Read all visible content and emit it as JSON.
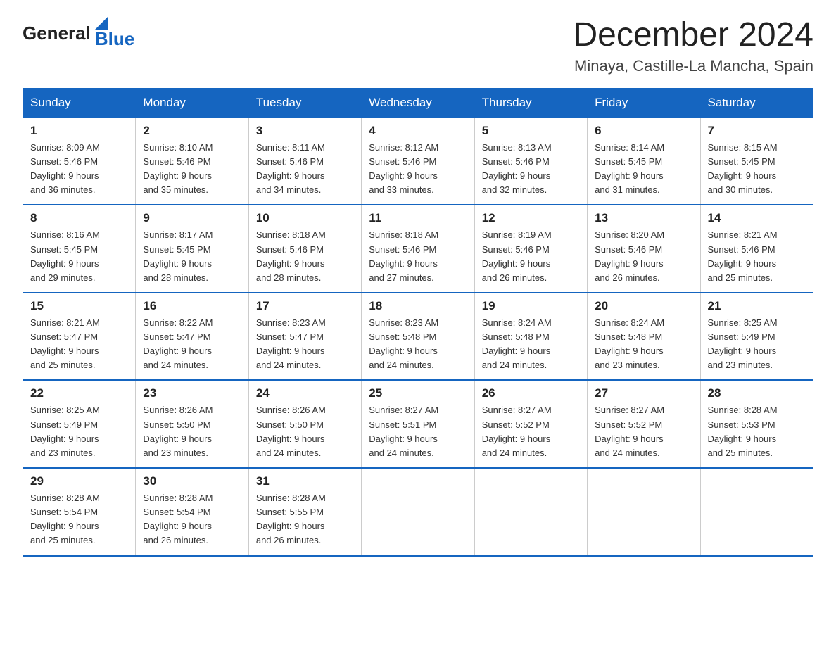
{
  "logo": {
    "general": "General",
    "blue": "Blue"
  },
  "title": "December 2024",
  "subtitle": "Minaya, Castille-La Mancha, Spain",
  "days_of_week": [
    "Sunday",
    "Monday",
    "Tuesday",
    "Wednesday",
    "Thursday",
    "Friday",
    "Saturday"
  ],
  "weeks": [
    [
      {
        "num": "1",
        "sunrise": "8:09 AM",
        "sunset": "5:46 PM",
        "daylight": "9 hours and 36 minutes."
      },
      {
        "num": "2",
        "sunrise": "8:10 AM",
        "sunset": "5:46 PM",
        "daylight": "9 hours and 35 minutes."
      },
      {
        "num": "3",
        "sunrise": "8:11 AM",
        "sunset": "5:46 PM",
        "daylight": "9 hours and 34 minutes."
      },
      {
        "num": "4",
        "sunrise": "8:12 AM",
        "sunset": "5:46 PM",
        "daylight": "9 hours and 33 minutes."
      },
      {
        "num": "5",
        "sunrise": "8:13 AM",
        "sunset": "5:46 PM",
        "daylight": "9 hours and 32 minutes."
      },
      {
        "num": "6",
        "sunrise": "8:14 AM",
        "sunset": "5:45 PM",
        "daylight": "9 hours and 31 minutes."
      },
      {
        "num": "7",
        "sunrise": "8:15 AM",
        "sunset": "5:45 PM",
        "daylight": "9 hours and 30 minutes."
      }
    ],
    [
      {
        "num": "8",
        "sunrise": "8:16 AM",
        "sunset": "5:45 PM",
        "daylight": "9 hours and 29 minutes."
      },
      {
        "num": "9",
        "sunrise": "8:17 AM",
        "sunset": "5:45 PM",
        "daylight": "9 hours and 28 minutes."
      },
      {
        "num": "10",
        "sunrise": "8:18 AM",
        "sunset": "5:46 PM",
        "daylight": "9 hours and 28 minutes."
      },
      {
        "num": "11",
        "sunrise": "8:18 AM",
        "sunset": "5:46 PM",
        "daylight": "9 hours and 27 minutes."
      },
      {
        "num": "12",
        "sunrise": "8:19 AM",
        "sunset": "5:46 PM",
        "daylight": "9 hours and 26 minutes."
      },
      {
        "num": "13",
        "sunrise": "8:20 AM",
        "sunset": "5:46 PM",
        "daylight": "9 hours and 26 minutes."
      },
      {
        "num": "14",
        "sunrise": "8:21 AM",
        "sunset": "5:46 PM",
        "daylight": "9 hours and 25 minutes."
      }
    ],
    [
      {
        "num": "15",
        "sunrise": "8:21 AM",
        "sunset": "5:47 PM",
        "daylight": "9 hours and 25 minutes."
      },
      {
        "num": "16",
        "sunrise": "8:22 AM",
        "sunset": "5:47 PM",
        "daylight": "9 hours and 24 minutes."
      },
      {
        "num": "17",
        "sunrise": "8:23 AM",
        "sunset": "5:47 PM",
        "daylight": "9 hours and 24 minutes."
      },
      {
        "num": "18",
        "sunrise": "8:23 AM",
        "sunset": "5:48 PM",
        "daylight": "9 hours and 24 minutes."
      },
      {
        "num": "19",
        "sunrise": "8:24 AM",
        "sunset": "5:48 PM",
        "daylight": "9 hours and 24 minutes."
      },
      {
        "num": "20",
        "sunrise": "8:24 AM",
        "sunset": "5:48 PM",
        "daylight": "9 hours and 23 minutes."
      },
      {
        "num": "21",
        "sunrise": "8:25 AM",
        "sunset": "5:49 PM",
        "daylight": "9 hours and 23 minutes."
      }
    ],
    [
      {
        "num": "22",
        "sunrise": "8:25 AM",
        "sunset": "5:49 PM",
        "daylight": "9 hours and 23 minutes."
      },
      {
        "num": "23",
        "sunrise": "8:26 AM",
        "sunset": "5:50 PM",
        "daylight": "9 hours and 23 minutes."
      },
      {
        "num": "24",
        "sunrise": "8:26 AM",
        "sunset": "5:50 PM",
        "daylight": "9 hours and 24 minutes."
      },
      {
        "num": "25",
        "sunrise": "8:27 AM",
        "sunset": "5:51 PM",
        "daylight": "9 hours and 24 minutes."
      },
      {
        "num": "26",
        "sunrise": "8:27 AM",
        "sunset": "5:52 PM",
        "daylight": "9 hours and 24 minutes."
      },
      {
        "num": "27",
        "sunrise": "8:27 AM",
        "sunset": "5:52 PM",
        "daylight": "9 hours and 24 minutes."
      },
      {
        "num": "28",
        "sunrise": "8:28 AM",
        "sunset": "5:53 PM",
        "daylight": "9 hours and 25 minutes."
      }
    ],
    [
      {
        "num": "29",
        "sunrise": "8:28 AM",
        "sunset": "5:54 PM",
        "daylight": "9 hours and 25 minutes."
      },
      {
        "num": "30",
        "sunrise": "8:28 AM",
        "sunset": "5:54 PM",
        "daylight": "9 hours and 26 minutes."
      },
      {
        "num": "31",
        "sunrise": "8:28 AM",
        "sunset": "5:55 PM",
        "daylight": "9 hours and 26 minutes."
      },
      null,
      null,
      null,
      null
    ]
  ],
  "labels": {
    "sunrise": "Sunrise:",
    "sunset": "Sunset:",
    "daylight": "Daylight:"
  }
}
